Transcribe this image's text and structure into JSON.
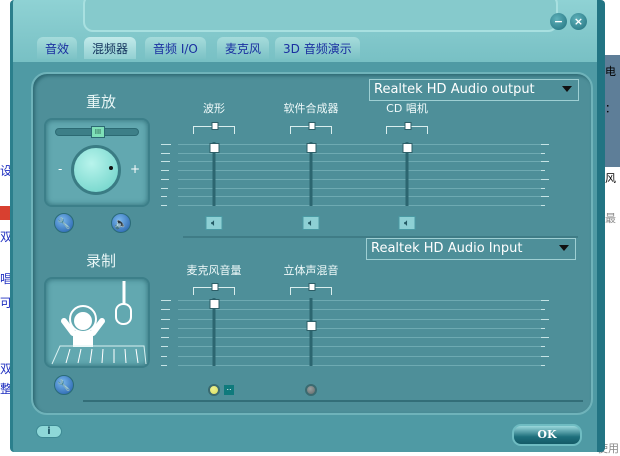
{
  "background_fragments": {
    "left": [
      "设",
      "双",
      "唱",
      "可",
      "双",
      "整"
    ],
    "right": [
      "电",
      "：",
      "风",
      "最",
      "使用"
    ]
  },
  "window": {
    "minimize_icon": "−",
    "close_icon": "×"
  },
  "tabs": [
    {
      "label": "音效"
    },
    {
      "label": "混频器",
      "active": true
    },
    {
      "label": "音频 I/O"
    },
    {
      "label": "麦克风"
    },
    {
      "label": "3D 音频演示"
    }
  ],
  "playback": {
    "title": "重放",
    "master": {
      "balance": 0.5,
      "volume": 0.8,
      "minus": "-",
      "plus": "+",
      "balance_grip": "III"
    },
    "device": "Realtek HD Audio output",
    "channels": [
      {
        "label": "波形",
        "balance": 0.5,
        "volume": 0.95,
        "muted": false
      },
      {
        "label": "软件合成器",
        "balance": 0.5,
        "volume": 0.95,
        "muted": false
      },
      {
        "label": "CD 唱机",
        "balance": 0.5,
        "volume": 0.95,
        "muted": false
      }
    ]
  },
  "recording": {
    "title": "录制",
    "device": "Realtek HD Audio Input",
    "channels": [
      {
        "label": "麦克风音量",
        "balance": 0.5,
        "volume": 0.95,
        "selected": true,
        "extra": ".."
      },
      {
        "label": "立体声混音",
        "balance": 0.5,
        "volume": 0.63,
        "selected": false
      }
    ]
  },
  "footer": {
    "info_icon": "i",
    "ok_label": "OK"
  },
  "colors": {
    "window": "#4f9aa4",
    "panel": "#4e8f99",
    "tab_text": "#1a2fa0",
    "led_on": "#d8e060",
    "led_off": "#606868"
  }
}
